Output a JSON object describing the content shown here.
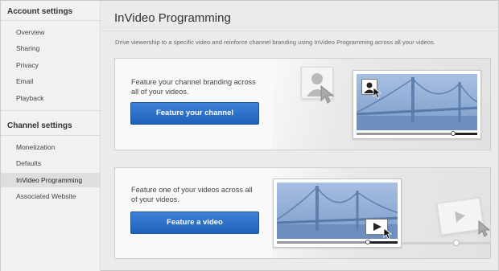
{
  "sidebar": {
    "account_heading": "Account settings",
    "account_items": [
      {
        "label": "Overview"
      },
      {
        "label": "Sharing"
      },
      {
        "label": "Privacy"
      },
      {
        "label": "Email"
      },
      {
        "label": "Playback"
      }
    ],
    "channel_heading": "Channel settings",
    "channel_items": [
      {
        "label": "Monetization"
      },
      {
        "label": "Defaults"
      },
      {
        "label": "InVideo Programming",
        "active": true
      },
      {
        "label": "Associated Website"
      }
    ]
  },
  "main": {
    "title": "InVideo Programming",
    "intro": "Drive viewership to a specific video and reinforce channel branding using InVideo Programming across all your videos.",
    "cards": [
      {
        "text": "Feature your channel branding across all of your videos.",
        "button_label": "Feature your channel"
      },
      {
        "text": "Feature one of your videos across all of your videos.",
        "button_label": "Feature a video"
      }
    ]
  },
  "colors": {
    "button_blue": "#2a6fcb",
    "video_blue": "#8fadd8",
    "active_item_bg": "#dedede"
  },
  "icons": [
    "avatar-icon",
    "cursor-icon",
    "play-icon",
    "bridge-illustration"
  ]
}
